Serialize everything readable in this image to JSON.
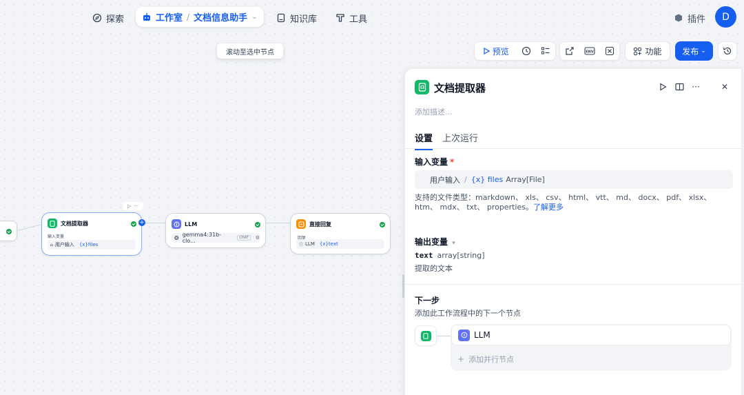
{
  "nav": {
    "explore": "探索",
    "studio": "工作室",
    "app_name": "文档信息助手",
    "knowledge": "知识库",
    "tools": "工具",
    "plugins": "插件",
    "avatar_initial": "D"
  },
  "canvas": {
    "tooltip": "滚动至选中节点"
  },
  "toolbar": {
    "preview": "预览",
    "features": "功能",
    "publish": "发布"
  },
  "nodes": {
    "extractor": {
      "title": "文档提取器",
      "input_label": "输入变量",
      "chip_source": "用户输入",
      "chip_var": "{x}files"
    },
    "llm": {
      "title": "LLM",
      "model": "gemma4:31b-clo...",
      "mode": "CHAT"
    },
    "answer": {
      "title": "直接回复",
      "answer_label": "回复",
      "chip_source": "LLM",
      "chip_var": "{x}text"
    }
  },
  "panel": {
    "title": "文档提取器",
    "description_placeholder": "添加描述...",
    "tabs": [
      "设置",
      "上次运行"
    ],
    "input_section": "输入变量",
    "input_required": "*",
    "input_source": "用户输入",
    "input_slash": "/",
    "input_var": "{x} files",
    "input_type": "Array[File]",
    "filetypes_text": "支持的文件类型：markdown、 xls、 csv、 html、 vtt、 md、 docx、 pdf、 xlsx、 htm、 mdx、 txt、 properties。",
    "learn_more": "了解更多",
    "output_section": "输出变量",
    "output_name": "text",
    "output_type": "array[string]",
    "output_desc": "提取的文本",
    "next_section": "下一步",
    "next_desc": "添加此工作流程中的下一个节点",
    "next_node": "LLM",
    "add_parallel": "添加并行节点"
  },
  "colors": {
    "accent": "#155eef",
    "extractor": "#12b76a",
    "llm": "#6172f3",
    "answer": "#f79009",
    "success": "#16a34a"
  }
}
